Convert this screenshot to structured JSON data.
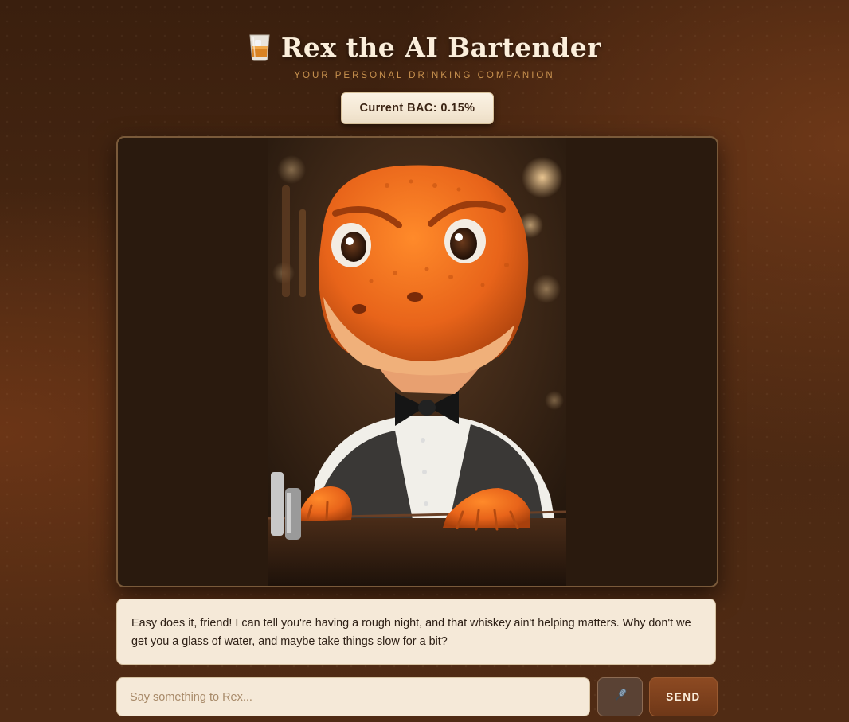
{
  "header": {
    "icon": "whiskey-glass-icon",
    "title": "Rex the AI Bartender",
    "subtitle": "YOUR PERSONAL DRINKING COMPANION"
  },
  "status": {
    "bac_label": "Current BAC: 0.15%"
  },
  "portrait": {
    "subject": "orange-dinosaur-bartender",
    "accent": "#e8641a"
  },
  "chat": {
    "message": "Easy does it, friend! I can tell you're having a rough night, and that whiskey ain't helping matters. Why don't we get you a glass of water, and maybe take things slow for a bit?",
    "input_placeholder": "Say something to Rex...",
    "input_value": "",
    "mic_icon": "microphone-icon",
    "send_label": "SEND"
  },
  "colors": {
    "background": "#4a2812",
    "panel": "#f5e9d8",
    "accent": "#c9924f",
    "send": "#7d4120"
  }
}
